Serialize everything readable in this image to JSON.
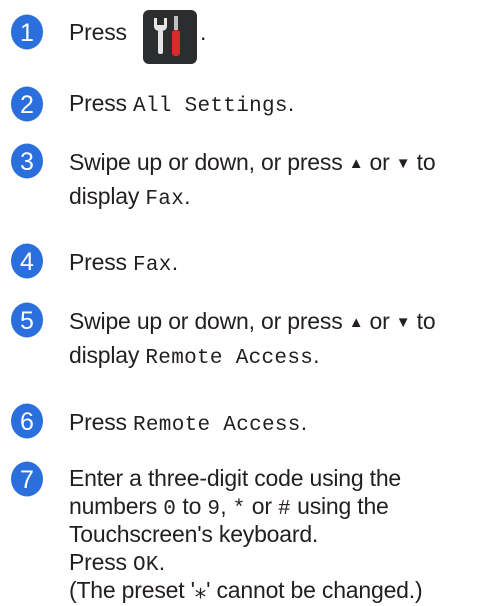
{
  "steps": [
    {
      "number": "1",
      "parts": [
        "Press",
        "."
      ]
    },
    {
      "number": "2",
      "parts": [
        "Press ",
        "All Settings",
        "."
      ]
    },
    {
      "number": "3",
      "lines": [
        [
          "Swipe up or down, or press ",
          "▲",
          " or ",
          "▼",
          " to"
        ],
        [
          "display ",
          "Fax",
          "."
        ]
      ]
    },
    {
      "number": "4",
      "parts": [
        "Press ",
        "Fax",
        "."
      ]
    },
    {
      "number": "5",
      "lines": [
        [
          "Swipe up or down, or press ",
          "▲",
          " or ",
          "▼",
          " to"
        ],
        [
          "display ",
          "Remote Access",
          "."
        ]
      ]
    },
    {
      "number": "6",
      "parts": [
        "Press ",
        "Remote Access",
        "."
      ]
    },
    {
      "number": "7",
      "lines": [
        [
          "Enter a three-digit code using the"
        ],
        [
          "numbers ",
          "0",
          " to ",
          "9",
          ", ",
          "*",
          " or ",
          "#",
          " using the"
        ],
        [
          "Touchscreen's keyboard."
        ],
        [
          "Press ",
          "OK",
          "."
        ],
        [
          "(The preset '",
          "⁎",
          "' cannot be changed.)"
        ]
      ]
    }
  ],
  "icons": {
    "step_badge": "numbered-circle-icon",
    "settings_button": "settings-tools-icon"
  },
  "colors": {
    "badge": "#2a6fdb",
    "badge_text": "#ffffff",
    "button_bg": "#2b2d2f"
  }
}
